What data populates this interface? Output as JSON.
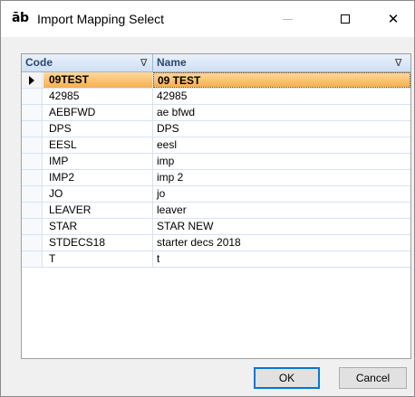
{
  "window": {
    "icon_glyph": "āb",
    "title": "Import Mapping Select",
    "close_glyph": "✕"
  },
  "grid": {
    "columns": [
      {
        "label": "Code",
        "filter_icon": "filter-icon"
      },
      {
        "label": "Name",
        "filter_icon": "filter-icon"
      }
    ],
    "filter_glyph": "∇",
    "selected_index": 0,
    "rows": [
      {
        "code": "09TEST",
        "name": "09 TEST"
      },
      {
        "code": "42985",
        "name": "42985"
      },
      {
        "code": "AEBFWD",
        "name": "ae bfwd"
      },
      {
        "code": "DPS",
        "name": "DPS"
      },
      {
        "code": "EESL",
        "name": "eesl"
      },
      {
        "code": "IMP",
        "name": "imp"
      },
      {
        "code": "IMP2",
        "name": "imp 2"
      },
      {
        "code": "JO",
        "name": "jo"
      },
      {
        "code": "LEAVER",
        "name": "leaver"
      },
      {
        "code": "STAR",
        "name": "STAR NEW"
      },
      {
        "code": "STDECS18",
        "name": "starter decs 2018"
      },
      {
        "code": "T",
        "name": "t"
      }
    ]
  },
  "buttons": {
    "ok_label": "OK",
    "cancel_label": "Cancel"
  },
  "colors": {
    "selected_row": "#f6b04e",
    "header_text": "#2c4870",
    "ok_border": "#0078d7"
  }
}
